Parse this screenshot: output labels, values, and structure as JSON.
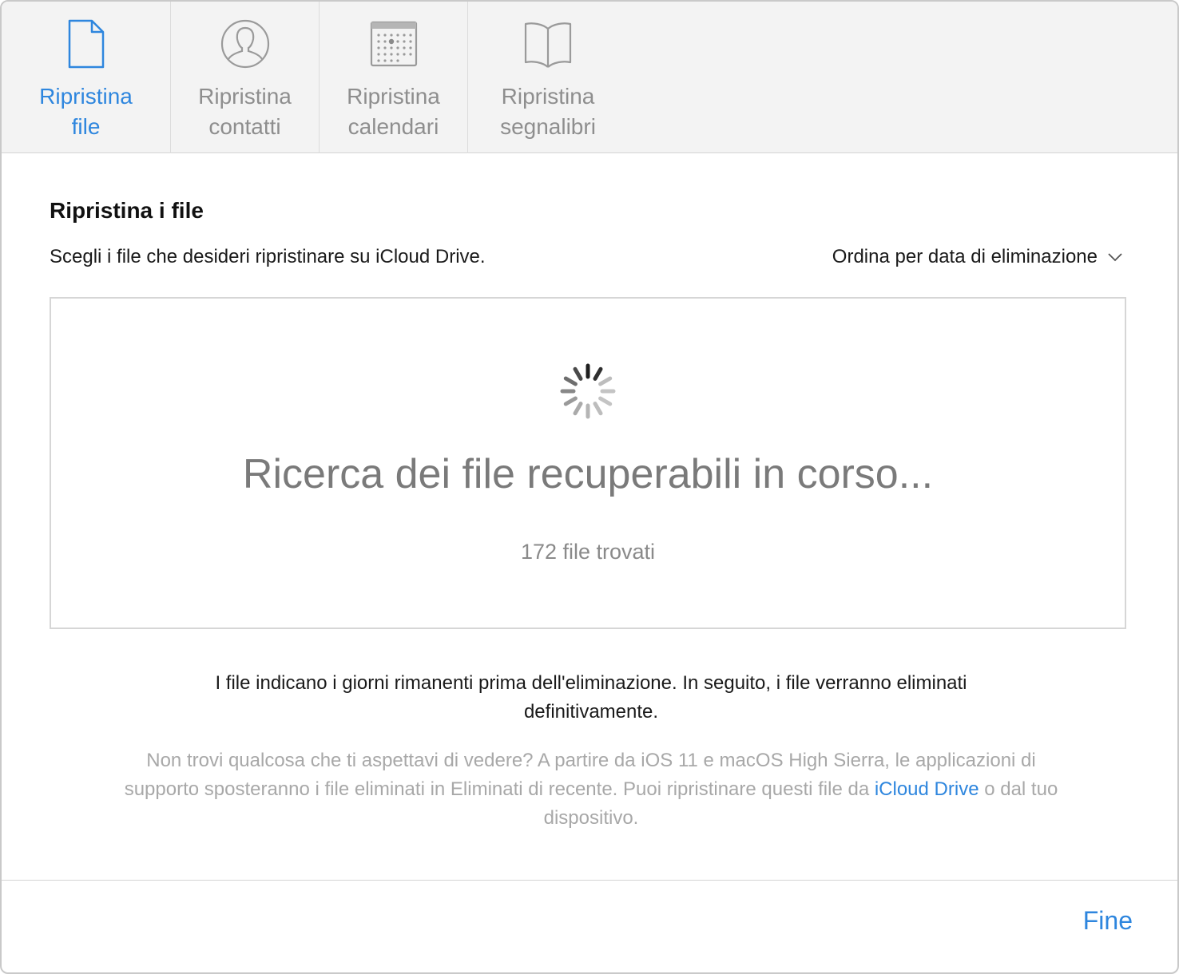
{
  "tabs": [
    {
      "label_line1": "Ripristina",
      "label_line2": "file",
      "icon": "document-icon",
      "active": true
    },
    {
      "label_line1": "Ripristina",
      "label_line2": "contatti",
      "icon": "contact-icon",
      "active": false
    },
    {
      "label_line1": "Ripristina",
      "label_line2": "calendari",
      "icon": "calendar-icon",
      "active": false
    },
    {
      "label_line1": "Ripristina",
      "label_line2": "segnalibri",
      "icon": "bookmark-book-icon",
      "active": false
    }
  ],
  "main": {
    "title": "Ripristina i file",
    "subtitle": "Scegli i file che desideri ripristinare su iCloud Drive.",
    "sort_label": "Ordina per data di eliminazione",
    "status": "Ricerca dei file recuperabili in corso...",
    "found_count": "172 file trovati",
    "info": "I file indicano i giorni rimanenti prima dell'eliminazione. In seguito, i file verranno eliminati definitivamente.",
    "hint_before": "Non trovi qualcosa che ti aspettavi di vedere? A partire da iOS 11 e macOS High Sierra, le applicazioni di supporto sposteranno i file eliminati in Eliminati di recente. Puoi ripristinare questi file da ",
    "hint_link": "iCloud Drive",
    "hint_after": " o dal tuo dispositivo."
  },
  "footer": {
    "done_label": "Fine"
  },
  "colors": {
    "accent": "#2e86de",
    "inactive_tab": "#8e8e8e",
    "toolbar_bg": "#f3f3f3"
  }
}
